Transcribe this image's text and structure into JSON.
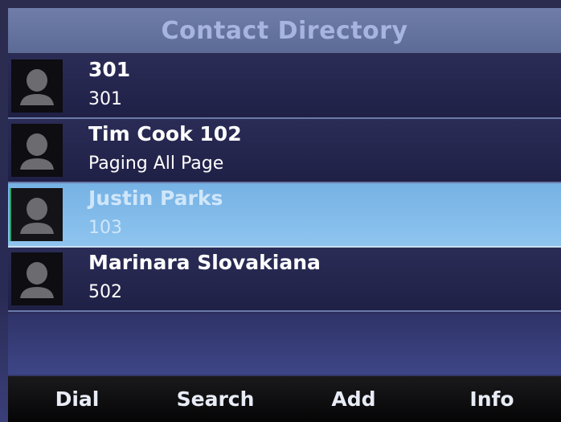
{
  "header": {
    "title": "Contact Directory"
  },
  "contacts": [
    {
      "name": "301",
      "number": "301",
      "icon": "contact-avatar-icon"
    },
    {
      "name": "Tim Cook 102",
      "number": "Paging All Page",
      "icon": "contact-avatar-icon"
    },
    {
      "name": "Justin Parks",
      "number": "103",
      "icon": "contact-avatar-icon",
      "selected": true
    },
    {
      "name": "Marinara Slovakiana",
      "number": "502",
      "icon": "contact-avatar-icon"
    }
  ],
  "softkeys": {
    "dial": "Dial",
    "search": "Search",
    "add": "Add",
    "info": "Info"
  },
  "colors": {
    "header_bg": "#6f7da8",
    "header_text": "#a8b4e0",
    "row_bg": "#2b2c56",
    "selected_bg": "#8ec4ef",
    "softkey_bg": "#0a0a0c"
  }
}
